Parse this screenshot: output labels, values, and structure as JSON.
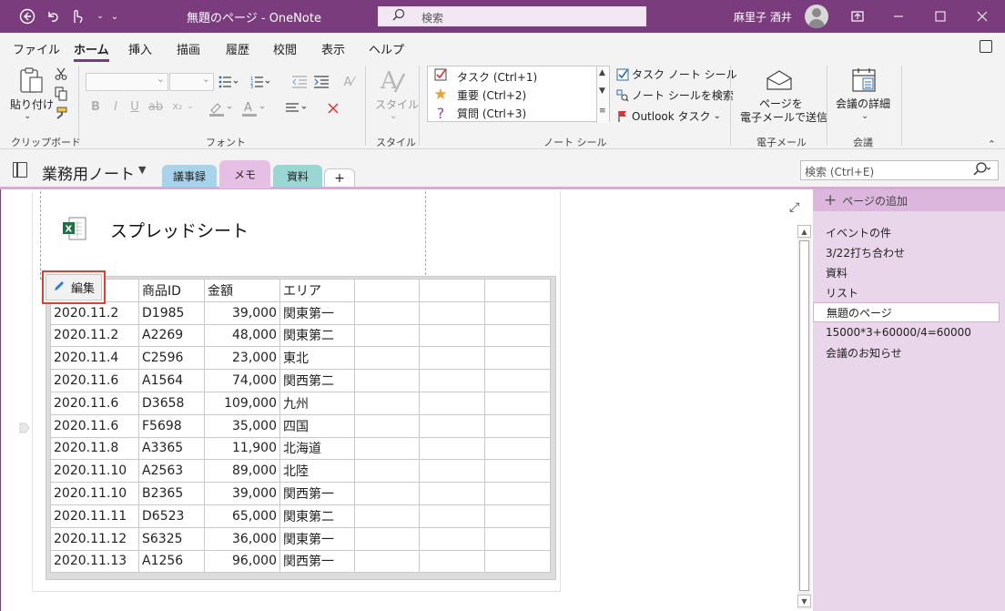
{
  "window": {
    "title": "無題のページ  -  OneNote",
    "search_placeholder": "検索",
    "user_name": "麻里子 酒井"
  },
  "ribbon_tabs": [
    "ファイル",
    "ホーム",
    "挿入",
    "描画",
    "履歴",
    "校閲",
    "表示",
    "ヘルプ"
  ],
  "ribbon": {
    "clipboard": {
      "paste_label": "貼り付け",
      "group_label": "クリップボード"
    },
    "font": {
      "group_label": "フォント"
    },
    "style": {
      "label": "スタイル",
      "group_label": "スタイル"
    },
    "tags": {
      "items": [
        {
          "icon": "checkbox-icon",
          "label": "タスク (Ctrl+1)"
        },
        {
          "icon": "star-icon",
          "label": "重要 (Ctrl+2)"
        },
        {
          "icon": "question-icon",
          "label": "質問 (Ctrl+3)"
        }
      ],
      "task_note_tag": "タスク ノート シール",
      "find_tags": "ノート シールを検索",
      "outlook_tasks": "Outlook タスク",
      "group_label": "ノート シール"
    },
    "email": {
      "line1": "ページを",
      "line2": "電子メールで送信",
      "group_label": "電子メール"
    },
    "meeting": {
      "label": "会議の詳細",
      "group_label": "会議"
    }
  },
  "notebook": {
    "name": "業務用ノート",
    "sections": [
      {
        "label": "議事録",
        "color": "#a9d3ea"
      },
      {
        "label": "メモ",
        "color": "#e6bfe5"
      },
      {
        "label": "資料",
        "color": "#9ad6d2"
      },
      {
        "label": "+",
        "color": "#ffffff"
      }
    ],
    "search_placeholder": "検索 (Ctrl+E)"
  },
  "page": {
    "file_name": "スプレッドシート",
    "edit_label": "編集",
    "table": {
      "header": [
        "",
        "商品ID",
        "金額",
        "エリア",
        "",
        "",
        ""
      ],
      "rows": [
        [
          "2020.11.2",
          "D1985",
          "39,000",
          "関東第一"
        ],
        [
          "2020.11.2",
          "A2269",
          "48,000",
          "関東第二"
        ],
        [
          "2020.11.4",
          "C2596",
          "23,000",
          "東北"
        ],
        [
          "2020.11.6",
          "A1564",
          "74,000",
          "関西第二"
        ],
        [
          "2020.11.6",
          "D3658",
          "109,000",
          "九州"
        ],
        [
          "2020.11.6",
          "F5698",
          "35,000",
          "四国"
        ],
        [
          "2020.11.8",
          "A3365",
          "11,900",
          "北海道"
        ],
        [
          "2020.11.10",
          "A2563",
          "89,000",
          "北陸"
        ],
        [
          "2020.11.10",
          "B2365",
          "39,000",
          "関西第一"
        ],
        [
          "2020.11.11",
          "D6523",
          "65,000",
          "関東第二"
        ],
        [
          "2020.11.12",
          "S6325",
          "36,000",
          "関東第一"
        ],
        [
          "2020.11.13",
          "A1256",
          "96,000",
          "関西第一"
        ]
      ]
    }
  },
  "pages_pane": {
    "add_page": "ページの追加",
    "pages": [
      "イベントの件",
      "3/22打ち合わせ",
      "資料",
      "リスト",
      "無題のページ",
      "15000*3+60000/4=60000",
      "会議のお知らせ"
    ],
    "selected_index": 4
  },
  "colors": {
    "accent": "#7b3c7e",
    "highlight": "#e53d2f"
  }
}
